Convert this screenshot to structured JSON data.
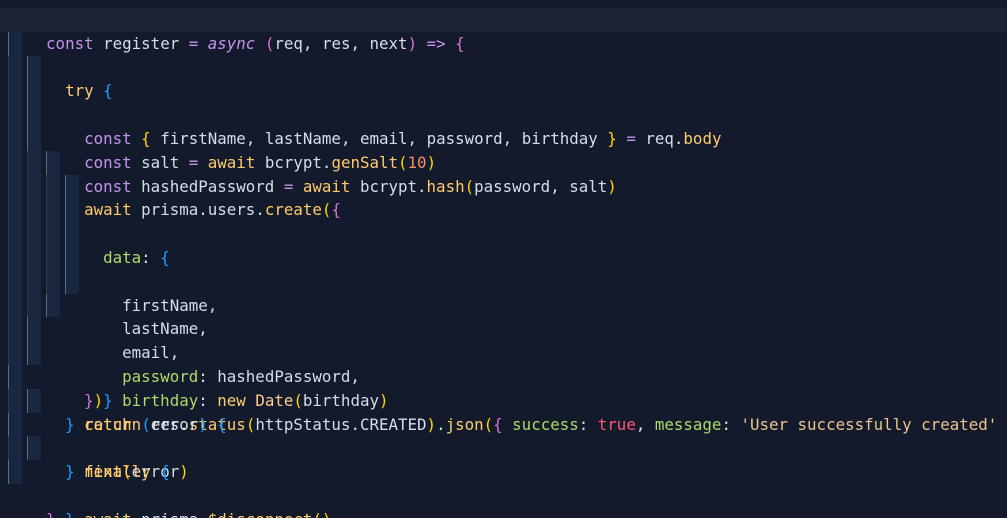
{
  "editor": {
    "lines": [
      "const register = async (req, res, next) => {",
      "  try {",
      "    const { firstName, lastName, email, password, birthday } = req.body",
      "    const salt = await bcrypt.genSalt(10)",
      "    const hashedPassword = await bcrypt.hash(password, salt)",
      "    await prisma.users.create({",
      "      data: {",
      "        firstName,",
      "        lastName,",
      "        email,",
      "        password: hashedPassword,",
      "        birthday: new Date(birthday)",
      "      }",
      "    })",
      "    return res.status(httpStatus.CREATED).json({ success: true, message: 'User successfully created' })",
      "  } catch (error) {",
      "    next(error)",
      "  } finally {",
      "    await prisma.$disconnect()",
      "  }",
      "}"
    ],
    "current_line": 1
  },
  "colors": {
    "background": "#121a2c",
    "keyword": "#c792ea",
    "control": "#ffcb6b",
    "string": "#ecc48d",
    "number": "#f78c6c",
    "property": "#addb67",
    "boolean": "#ff5874"
  }
}
